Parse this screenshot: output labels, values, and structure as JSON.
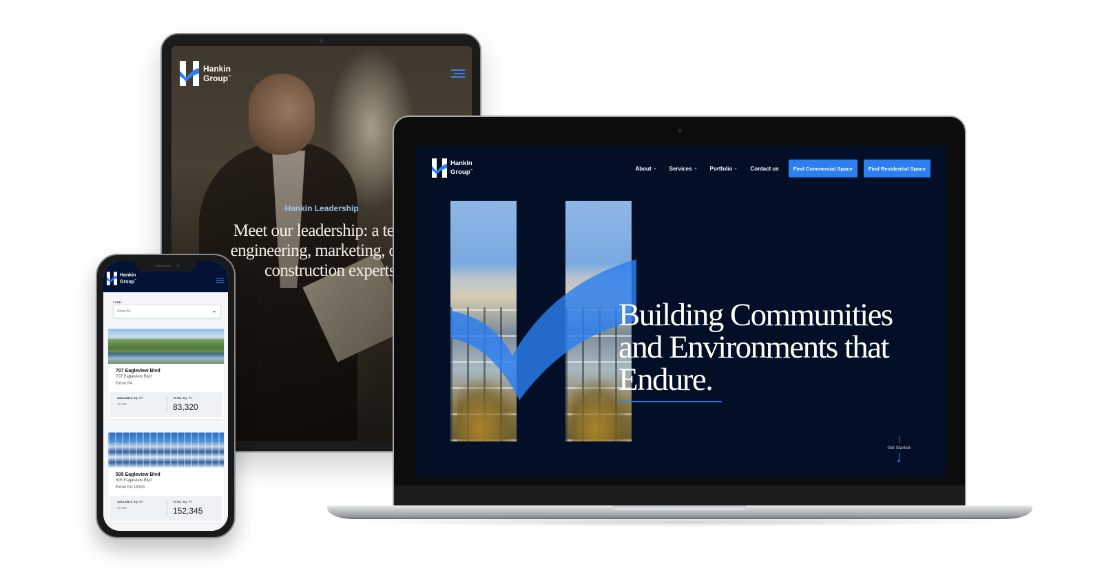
{
  "brand": {
    "name_line1": "Hankin",
    "name_line2": "Group",
    "trademark": "™",
    "colors": {
      "navy": "#020f26",
      "accent_blue": "#2b7ff0",
      "eyebrow_blue": "#9bc2ec"
    }
  },
  "tablet": {
    "menu_icon": "hamburger-icon",
    "eyebrow": "Hankin Leadership",
    "headline_lines": [
      "Meet our leadership: a team o",
      "engineering, marketing, operat",
      "construction experts"
    ]
  },
  "laptop": {
    "nav": [
      {
        "label": "About",
        "has_dropdown": true
      },
      {
        "label": "Services",
        "has_dropdown": true
      },
      {
        "label": "Portfolio",
        "has_dropdown": true
      },
      {
        "label": "Contact us",
        "has_dropdown": false
      }
    ],
    "buttons": [
      {
        "label": "Find Commercial Space"
      },
      {
        "label": "Find Residential Space"
      }
    ],
    "hero": {
      "headline_lines": [
        "Building Communities",
        "and Environments that",
        "Endure."
      ]
    },
    "scroll_cta": "Get Started"
  },
  "phone": {
    "menu_icon": "hamburger-icon",
    "filter": {
      "label": "TYPE:",
      "value": "Show All"
    },
    "listings": [
      {
        "title": "707 Eagleview Blvd",
        "address_line1": "707 Eagleview Blvd",
        "address_line2": "Exton PA",
        "available_label": "AVAILABLE SQ. FT.",
        "available_value": "10,756",
        "total_label": "TOTAL SQ. FT.",
        "total_value": "83,320"
      },
      {
        "title": "505 Eagleview Blvd",
        "address_line1": "505 Eagleview Blvd",
        "address_line2": "Exton PA 19341",
        "available_label": "AVAILABLE SQ. FT.",
        "available_value": "37,849",
        "total_label": "TOTAL SQ. FT.",
        "total_value": "152,345"
      }
    ]
  }
}
